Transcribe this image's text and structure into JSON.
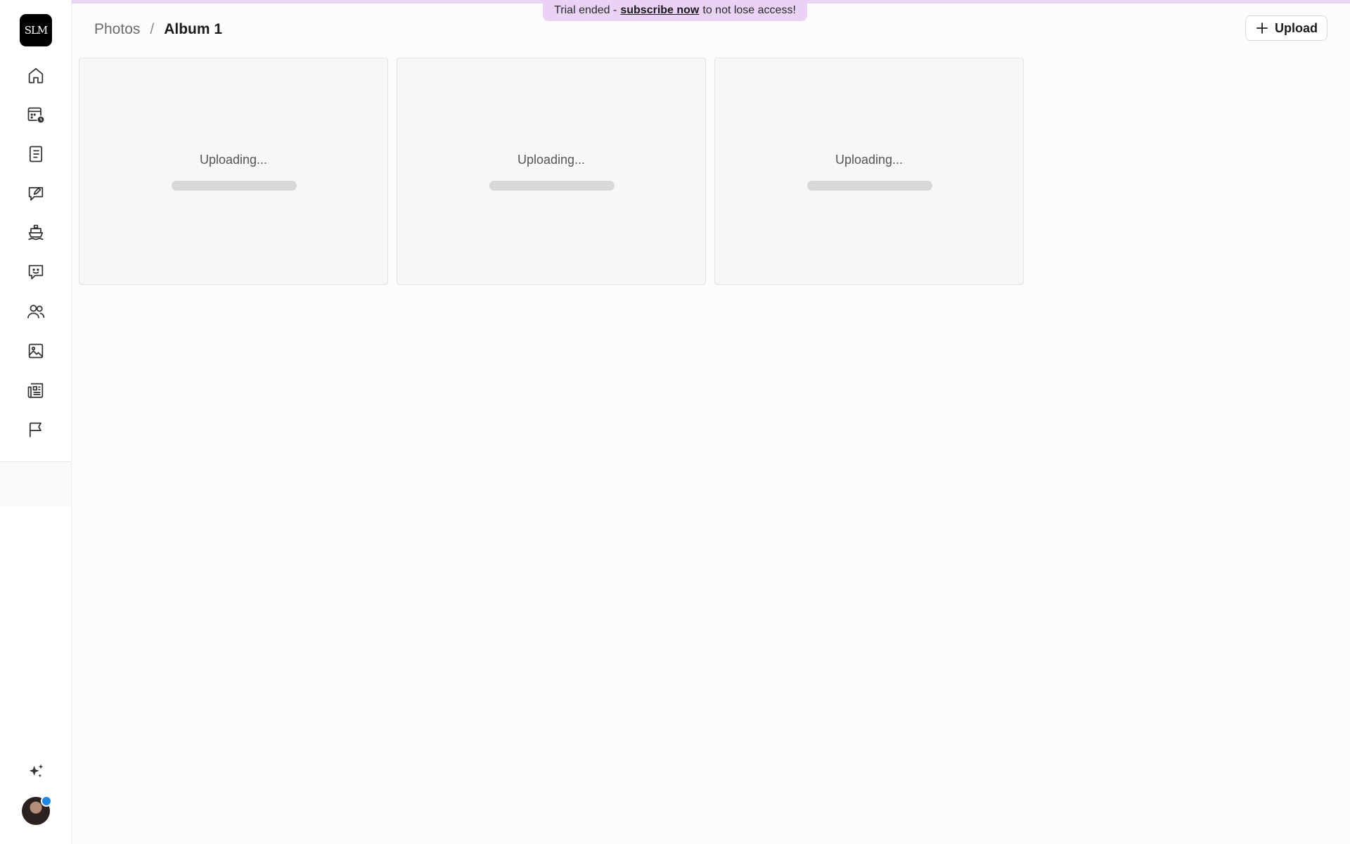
{
  "banner": {
    "prefix": "Trial ended -",
    "link": "subscribe now",
    "suffix": "to not lose access!",
    "color": "#ead2f6"
  },
  "logo": {
    "text": "SLM"
  },
  "sidebar": {
    "items": [
      {
        "icon": "home-icon"
      },
      {
        "icon": "calendar-clock-icon"
      },
      {
        "icon": "notebook-icon"
      },
      {
        "icon": "edit-message-icon"
      },
      {
        "icon": "ship-icon"
      },
      {
        "icon": "smile-message-icon"
      },
      {
        "icon": "users-icon"
      },
      {
        "icon": "image-icon"
      },
      {
        "icon": "newspaper-icon"
      },
      {
        "icon": "flag-icon"
      }
    ],
    "bottom": [
      {
        "icon": "sparkles-icon"
      },
      {
        "icon": "avatar",
        "status_color": "#1e88e5"
      }
    ]
  },
  "breadcrumb": {
    "parent": "Photos",
    "separator": "/",
    "current": "Album 1"
  },
  "toolbar": {
    "upload_label": "Upload",
    "upload_icon": "plus-icon"
  },
  "photos": [
    {
      "status": "Uploading...",
      "progress": 0.0
    },
    {
      "status": "Uploading...",
      "progress": 0.0
    },
    {
      "status": "Uploading...",
      "progress": 0.0
    }
  ]
}
